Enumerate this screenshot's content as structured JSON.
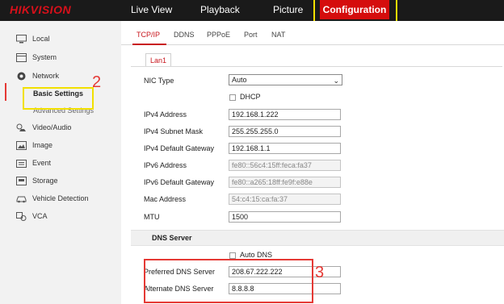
{
  "brand": {
    "logo_text": "HIKVISION",
    "accent": "#d50d0d"
  },
  "topnav": {
    "items": [
      "Live View",
      "Playback",
      "Picture"
    ],
    "active": "Configuration"
  },
  "annotations": {
    "one": "1",
    "two": "2",
    "three": "3"
  },
  "sidebar": {
    "items": [
      {
        "label": "Local",
        "icon": "monitor-icon"
      },
      {
        "label": "System",
        "icon": "system-icon"
      },
      {
        "label": "Network",
        "icon": "network-icon"
      },
      {
        "label": "Video/Audio",
        "icon": "video-audio-icon"
      },
      {
        "label": "Image",
        "icon": "image-icon"
      },
      {
        "label": "Event",
        "icon": "event-icon"
      },
      {
        "label": "Storage",
        "icon": "storage-icon"
      },
      {
        "label": "Vehicle Detection",
        "icon": "vehicle-icon"
      },
      {
        "label": "VCA",
        "icon": "vca-icon"
      }
    ],
    "sub_items": [
      "Basic Settings",
      "Advanced Settings"
    ]
  },
  "tabs": [
    "TCP/IP",
    "DDNS",
    "PPPoE",
    "Port",
    "NAT"
  ],
  "lan_tab": "Lan1",
  "form": {
    "nic_type": {
      "label": "NIC Type",
      "value": "Auto"
    },
    "dhcp": {
      "label": "DHCP",
      "checked": false
    },
    "ipv4_address": {
      "label": "IPv4 Address",
      "value": "192.168.1.222"
    },
    "ipv4_mask": {
      "label": "IPv4 Subnet Mask",
      "value": "255.255.255.0"
    },
    "ipv4_gateway": {
      "label": "IPv4 Default Gateway",
      "value": "192.168.1.1"
    },
    "ipv6_address": {
      "label": "IPv6 Address",
      "value": "fe80::56c4:15ff:feca:fa37"
    },
    "ipv6_gateway": {
      "label": "IPv6 Default Gateway",
      "value": "fe80::a265:18ff:fe9f:e88e"
    },
    "mac_address": {
      "label": "Mac Address",
      "value": "54:c4:15:ca:fa:37"
    },
    "mtu": {
      "label": "MTU",
      "value": "1500"
    }
  },
  "dns": {
    "title": "DNS Server",
    "auto_dns": {
      "label": "Auto DNS",
      "checked": false
    },
    "preferred": {
      "label": "Preferred DNS Server",
      "value": "208.67.222.222"
    },
    "alternate": {
      "label": "Alternate DNS Server",
      "value": "8.8.8.8"
    }
  }
}
